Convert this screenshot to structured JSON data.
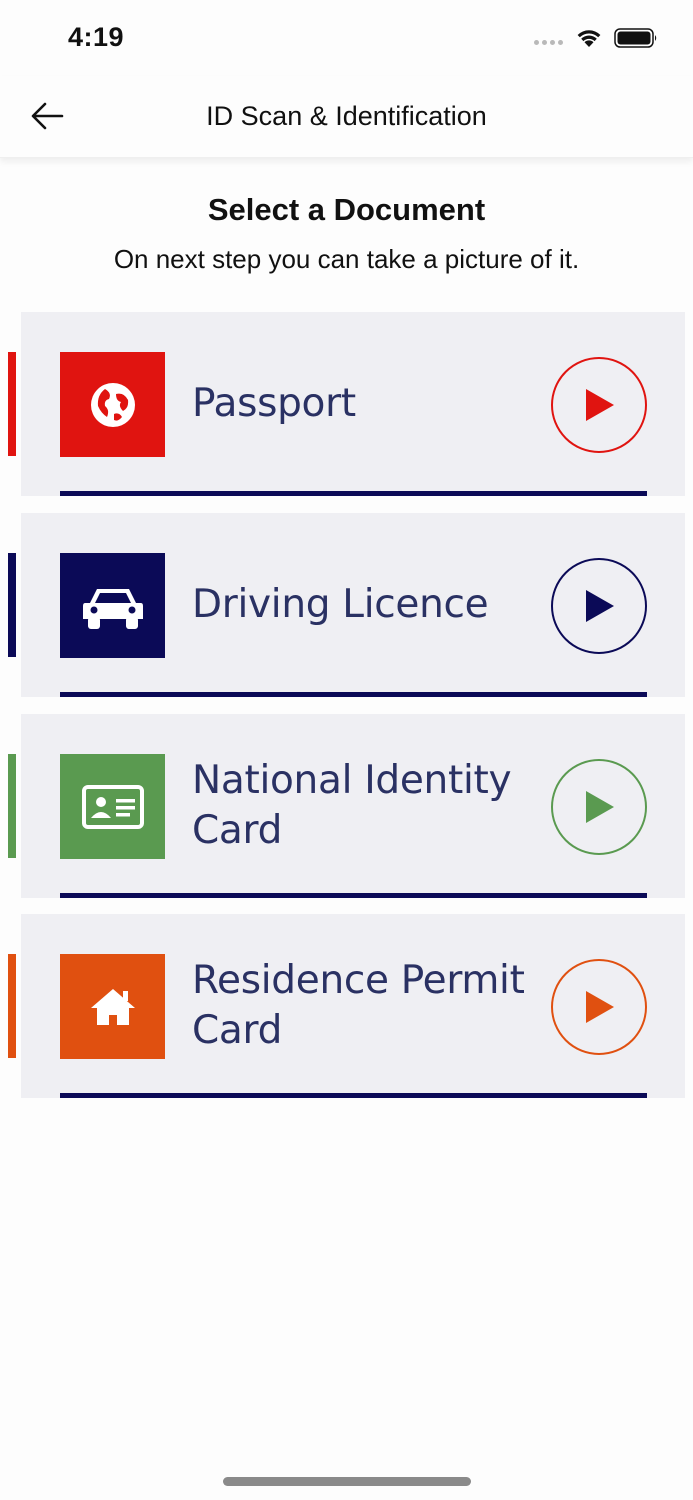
{
  "status_bar": {
    "time": "4:19"
  },
  "nav": {
    "title": "ID Scan & Identification"
  },
  "header": {
    "title": "Select a Document",
    "subtitle": "On next step you can take a picture of it."
  },
  "documents": [
    {
      "line1": "Passport",
      "line2": "",
      "color": "#e01410",
      "icon": "globe-icon"
    },
    {
      "line1": "Driving Licence",
      "line2": "",
      "color": "#0b0a57",
      "icon": "car-icon"
    },
    {
      "line1": "National Identity",
      "line2": "Card",
      "color": "#5a9a50",
      "icon": "id-card-icon"
    },
    {
      "line1": "Residence Permit",
      "line2": "Card",
      "color": "#e05010",
      "icon": "home-icon"
    }
  ]
}
